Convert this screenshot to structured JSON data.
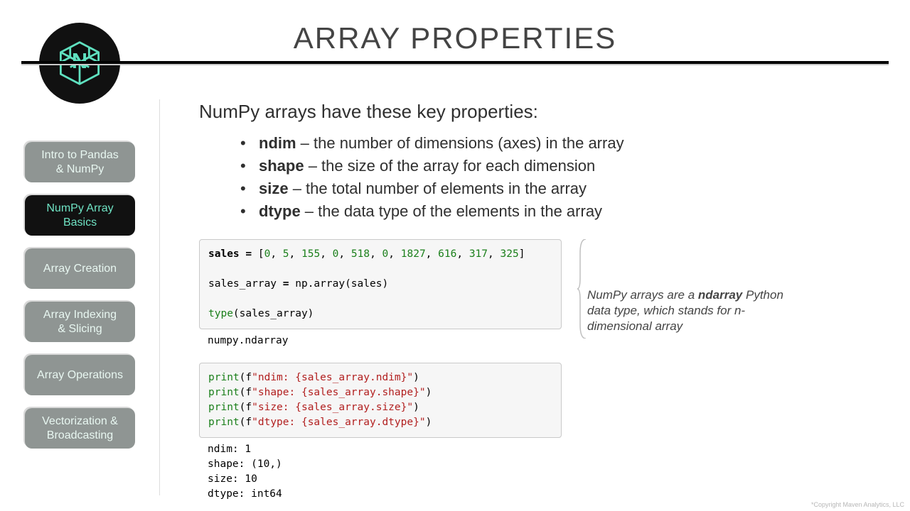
{
  "title": "ARRAY PROPERTIES",
  "sidebar": {
    "items": [
      {
        "label_html": "Intro to Pandas\n& NumPy",
        "active": false
      },
      {
        "label_html": "NumPy Array\nBasics",
        "active": true
      },
      {
        "label_html": "Array Creation",
        "active": false
      },
      {
        "label_html": "Array Indexing\n& Slicing",
        "active": false
      },
      {
        "label_html": "Array Operations",
        "active": false
      },
      {
        "label_html": "Vectorization &\nBroadcasting",
        "active": false
      }
    ]
  },
  "lead": "NumPy arrays have these key properties:",
  "properties": [
    {
      "name": "ndim",
      "desc": " – the number of dimensions (axes) in the array"
    },
    {
      "name": "shape",
      "desc": " – the size of the array for each dimension"
    },
    {
      "name": "size",
      "desc": " – the total number of elements in the array"
    },
    {
      "name": "dtype",
      "desc": " – the data type of the elements in the array"
    }
  ],
  "code1": {
    "line1_pre": "sales ",
    "line1_eq": "=",
    "line1_post": " [",
    "values": [
      "0",
      "5",
      "155",
      "0",
      "518",
      "0",
      "1827",
      "616",
      "317",
      "325"
    ],
    "line1_end": "]",
    "line2": "sales_array = np.array(sales)",
    "line3_fn": "type",
    "line3_rest": "(sales_array)"
  },
  "output1": "numpy.ndarray",
  "note_html": "NumPy arrays are a <b>ndarray</b> Python data type, which stands for n-dimensional array",
  "code2": [
    {
      "fn": "print",
      "open": "(f",
      "str": "\"ndim: {sales_array.ndim}\"",
      "close": ")"
    },
    {
      "fn": "print",
      "open": "(f",
      "str": "\"shape: {sales_array.shape}\"",
      "close": ")"
    },
    {
      "fn": "print",
      "open": "(f",
      "str": "\"size: {sales_array.size}\"",
      "close": ")"
    },
    {
      "fn": "print",
      "open": "(f",
      "str": "\"dtype: {sales_array.dtype}\"",
      "close": ")"
    }
  ],
  "output2": "ndim: 1\nshape: (10,)\nsize: 10\ndtype: int64",
  "footer": "*Copyright Maven Analytics, LLC"
}
